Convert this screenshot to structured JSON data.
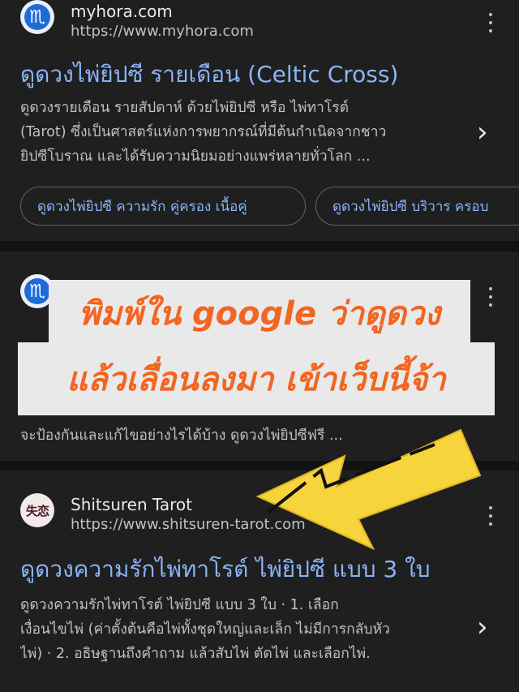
{
  "results": [
    {
      "site_name": "myhora.com",
      "url": "https://www.myhora.com",
      "icon": "myhora-icon",
      "icon_glyph": "♏",
      "title": "ดูดวงไพ่ยิปซี รายเดือน (Celtic Cross)",
      "snippet": [
        "ดูดวงรายเดือน รายสัปดาห์ ด้วยไพ่ยิปซี หรือ ไพ่ทาโรต์",
        "(Tarot) ซึ่งเป็นศาสตร์แห่งการพยากรณ์ที่มีต้นกำเนิดจากชาว",
        "ยิปซีโบราณ และได้รับความนิยมอย่างแพร่หลายทั่วโลก ..."
      ],
      "chips": [
        "ดูดวงไพ่ยิปซี ความรัก คู่ครอง เนื้อคู่",
        "ดูดวงไพ่ยิปซี บริวาร ครอบ"
      ]
    },
    {
      "icon": "myhora-icon",
      "icon_glyph": "♏",
      "snippet_last_line": "จะป้องกันและแก้ไขอย่างไรได้บ้าง ดูดวงไพ่ยิปซีฟรี ..."
    },
    {
      "site_name": "Shitsuren Tarot",
      "url": "https://www.shitsuren-tarot.com",
      "icon": "shitsuren-icon",
      "icon_glyph": "失恋",
      "title": "ดูดวงความรักไพ่ทาโรต์ ไพ่ยิปซี แบบ 3 ใบ",
      "snippet": [
        "ดูดวงความรักไพ่ทาโรต์ ไพ่ยิปซี แบบ 3 ใบ · 1. เลือก",
        "เงื่อนไขไพ่ (ค่าตั้งต้นคือไพ่ทั้งชุดใหญ่และเล็ก ไม่มีการกลับหัว",
        "ไพ่) · 2. อธิษฐานถึงคำถาม แล้วสับไพ่ ตัดไพ่ และเลือกไพ่."
      ]
    }
  ],
  "overlay": {
    "line1": "พิมพ์ใน google ว่าดูดวง",
    "line2": "แล้วเลื่อนลงมา เข้าเว็บนี้จ้า"
  },
  "colors": {
    "background": "#121212",
    "card": "#1f1f1f",
    "link": "#8ab4f8",
    "overlay_text": "#f26522",
    "arrow": "#f7d33c"
  }
}
